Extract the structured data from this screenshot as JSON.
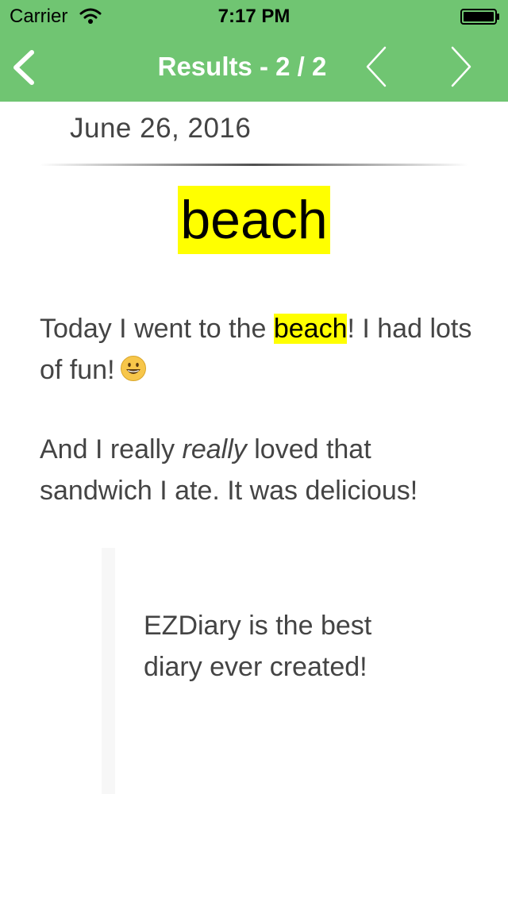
{
  "status_bar": {
    "carrier": "Carrier",
    "time": "7:17 PM"
  },
  "nav": {
    "title": "Results - 2 / 2",
    "back_icon": "chevron-left-icon",
    "prev_icon": "chevron-left-icon",
    "next_icon": "chevron-right-icon",
    "bar_color": "#70c572"
  },
  "entry": {
    "date": "June 26, 2016",
    "keyword": "beach",
    "highlight_color": "#ffff00",
    "paragraph1": {
      "before": "Today I went to the ",
      "highlight": "beach",
      "after": "! I had lots of fun!",
      "emoji_icon": "grinning-face-icon"
    },
    "paragraph2": {
      "before": "And I really ",
      "emphasis": "really",
      "after": " loved that sandwich I ate. It was delicious!"
    },
    "quote": "EZDiary is the best diary ever created!"
  }
}
